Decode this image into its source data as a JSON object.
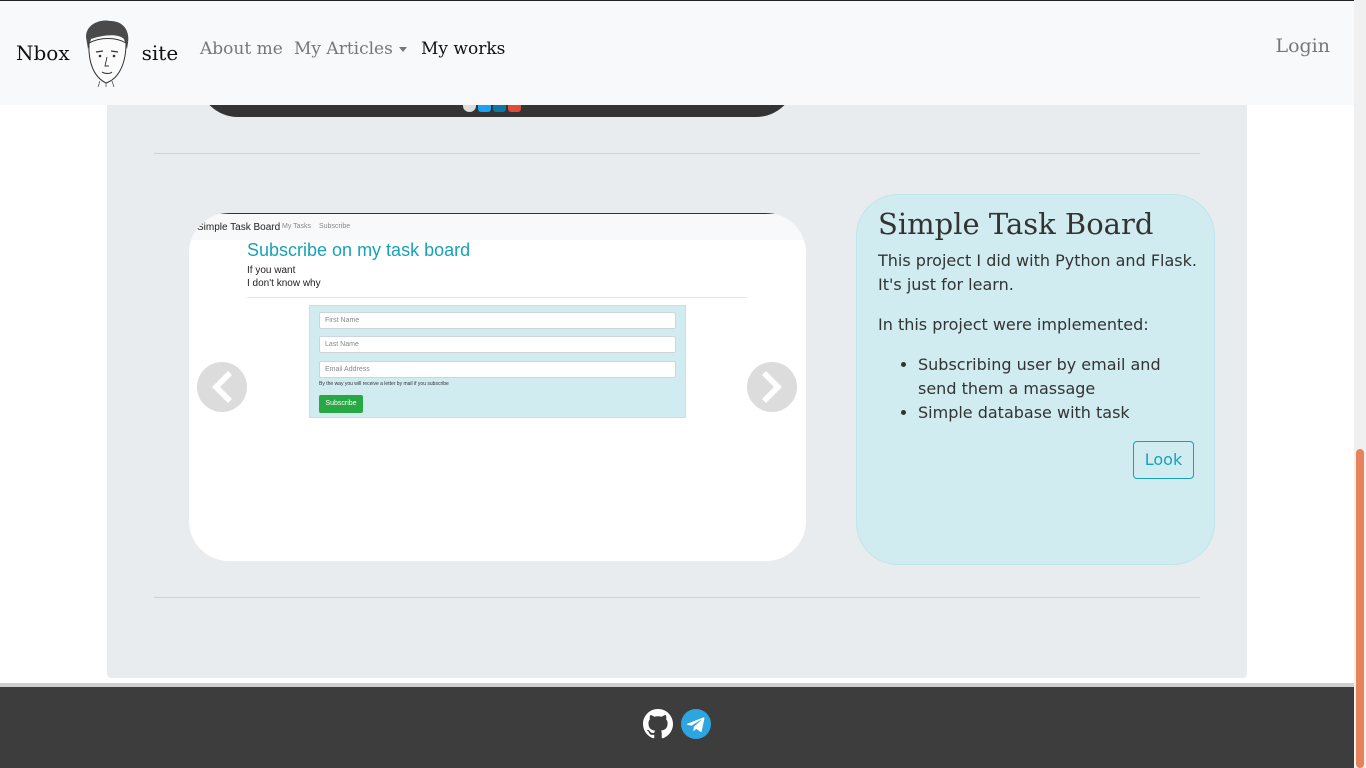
{
  "navbar": {
    "brand_left": "Nbox",
    "brand_right": "site",
    "links": [
      "About me",
      "My Articles",
      "My works"
    ],
    "login": "Login"
  },
  "project": {
    "title": "Simple Task Board",
    "description": "This project I did with Python and Flask. It's just for learn.",
    "implemented_heading": "In this project were implemented:",
    "features": [
      "Subscribing user by email and send them a massage",
      "Simple database with task"
    ],
    "look_button": "Look"
  },
  "carousel_slide": {
    "brand": "Simple Task Board",
    "nav_links": [
      "My Tasks",
      "Subscribe"
    ],
    "heading": "Subscribe on my task board",
    "lines": [
      "If you want",
      "I don't know why"
    ],
    "placeholders": [
      "First Name",
      "Last Name",
      "Email Address"
    ],
    "note": "By the way you will receive a letter by mail if you subscribe",
    "button": "Subscribe"
  },
  "footer": {
    "icons": [
      "github-icon",
      "telegram-icon"
    ]
  },
  "colors": {
    "accent": "#17a2b8",
    "card_bg": "#d1ecf1",
    "footer_bg": "#3d3d3d",
    "success": "#28a745",
    "scroll_thumb": "#e8825a"
  }
}
